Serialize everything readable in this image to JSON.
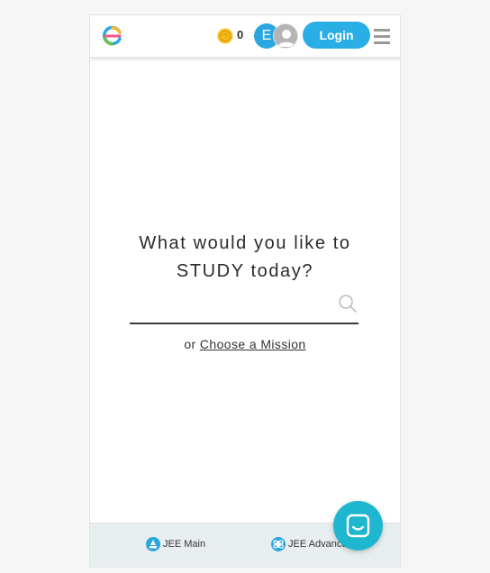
{
  "header": {
    "logo_icon": "embibe-logo-icon",
    "coin_icon": "coin-icon",
    "coins": "0",
    "avatar_letter": "E",
    "user_icon": "user-avatar-icon",
    "login_label": "Login",
    "menu_icon": "hamburger-menu-icon"
  },
  "main": {
    "prompt_line1": "What would you like to",
    "prompt_line2": "STUDY today?",
    "search": {
      "value": "",
      "placeholder": "",
      "icon": "search-icon"
    },
    "mission_prefix": "or",
    "mission_link": "Choose a Mission"
  },
  "bottom_nav": {
    "items": [
      {
        "label": "JEE Main",
        "icon": "jee-main-icon"
      },
      {
        "label": "JEE Advanced",
        "icon": "jee-advanced-icon"
      }
    ]
  },
  "chat": {
    "icon": "chat-icon"
  },
  "colors": {
    "accent": "#29aee6",
    "chat": "#1fb6cf",
    "nav_bg": "#e8eeef"
  }
}
